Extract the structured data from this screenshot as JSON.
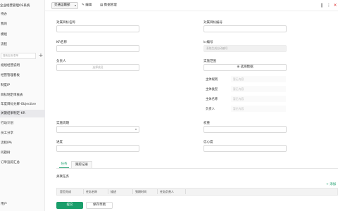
{
  "sidebar": {
    "title": "企业经营管理OS系统",
    "items": [
      {
        "label": "待办"
      },
      {
        "label": "我的"
      },
      {
        "label": "模组"
      },
      {
        "label": "流程"
      },
      {
        "label": "规划经营说明"
      },
      {
        "label": "经营管理看板"
      },
      {
        "label": "制度IP"
      },
      {
        "label": "目标制定审核表"
      },
      {
        "label": "年度目标分解-Objective"
      },
      {
        "label": "关键结果制定-KR"
      },
      {
        "label": "行动计划"
      },
      {
        "label": "员工分享"
      },
      {
        "label": "流程IPA"
      },
      {
        "label": "问题树"
      },
      {
        "label": "订单追踪汇总"
      }
    ],
    "search_placeholder": "搜索应用/表单",
    "add_glyph": "+",
    "user": "用户"
  },
  "toolbar": {
    "view_select": "交通运输部",
    "caret": "▾",
    "edit_label": "编辑",
    "data_manage_label": "数据管理",
    "edit_glyph": "✎",
    "data_glyph": "▤",
    "icons": [
      "bookmark-icon",
      "more-icon",
      "close-icon"
    ],
    "bookmark_glyph": "❙",
    "more_glyph": "⋮",
    "close_glyph": "✕"
  },
  "form": {
    "goal_name_label": "对属目标名称",
    "goal_no_label": "对属目标编号",
    "kr_name_label": "KR名称",
    "kr_no_label": "kr编号",
    "kr_no_value": "系统生成自动编号",
    "owner_label": "负责人",
    "owner_placeholder": "选择成员",
    "scope_label": "实施范围",
    "scope_button": "⊕ 选择数据",
    "scope_fields": [
      {
        "label": "主体规则",
        "value": "暂无内容"
      },
      {
        "label": "主体类型",
        "value": "暂无内容"
      },
      {
        "label": "主体名称",
        "value": "暂无内容"
      },
      {
        "label": "负责人",
        "value": "暂无内容"
      }
    ],
    "period_label": "实施周期",
    "weight_label": "权重",
    "progress_label": "进度",
    "confidence_label": "信心度",
    "caret": "▾"
  },
  "tabs": [
    {
      "label": "任务"
    },
    {
      "label": "跟踪记录"
    }
  ],
  "task_section": {
    "title": "关联任务",
    "add_label": "+ 添加",
    "columns": [
      "是否完成",
      "任务名称",
      "描述",
      "到期时间",
      "任务负责人"
    ]
  },
  "footer": {
    "submit_label": "提交",
    "save_draft_label": "保存草稿"
  },
  "colors": {
    "accent": "#1a9e6b",
    "close": "#dd3333"
  }
}
